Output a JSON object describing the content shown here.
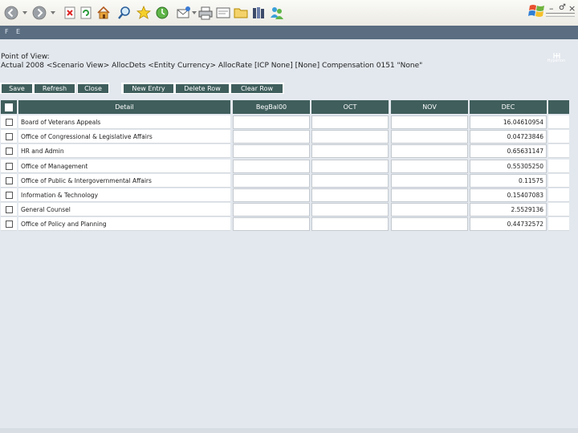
{
  "toolbar": {
    "buttons": [
      {
        "name": "back-icon"
      },
      {
        "name": "forward-icon"
      },
      {
        "name": "stop-icon"
      },
      {
        "name": "refresh-icon"
      },
      {
        "name": "home-icon"
      },
      {
        "name": "search-icon"
      },
      {
        "name": "favorites-icon"
      },
      {
        "name": "history-icon"
      },
      {
        "name": "mail-icon"
      },
      {
        "name": "print-icon"
      },
      {
        "name": "edit-icon"
      },
      {
        "name": "folder-icon"
      },
      {
        "name": "research-icon"
      },
      {
        "name": "messenger-icon"
      }
    ],
    "window_controls": {
      "minimize": "–",
      "restore": "♂",
      "close": "×"
    }
  },
  "appbar": {
    "items": [
      "F",
      "E"
    ],
    "logo": "Hyperion"
  },
  "pov": {
    "title": "Point of View:",
    "text": "Actual 2008 <Scenario View> AllocDets <Entity Currency> AllocRate [ICP None] [None] Compensation 0151 \"None\""
  },
  "actions": {
    "save": "Save",
    "refresh": "Refresh",
    "close": "Close",
    "new_entry": "New Entry",
    "delete_row": "Delete Row",
    "clear_row": "Clear Row"
  },
  "grid": {
    "headers": {
      "detail": "Detail",
      "begbal": "BegBal00",
      "oct": "OCT",
      "nov": "NOV",
      "dec": "DEC"
    },
    "rows": [
      {
        "label": "Board of Veterans Appeals",
        "dec": "16.04610954"
      },
      {
        "label": "Office of Congressional & Legislative Affairs",
        "dec": "0.04723846"
      },
      {
        "label": "HR and Admin",
        "dec": "0.65631147"
      },
      {
        "label": "Office of Management",
        "dec": "0.55305250"
      },
      {
        "label": "Office of Public & Intergovernmental Affairs",
        "dec": "0.11575"
      },
      {
        "label": "Information & Technology",
        "dec": "0.15407083"
      },
      {
        "label": "General Counsel",
        "dec": "2.5529136"
      },
      {
        "label": "Office of Policy and Planning",
        "dec": "0.44732572"
      }
    ]
  }
}
